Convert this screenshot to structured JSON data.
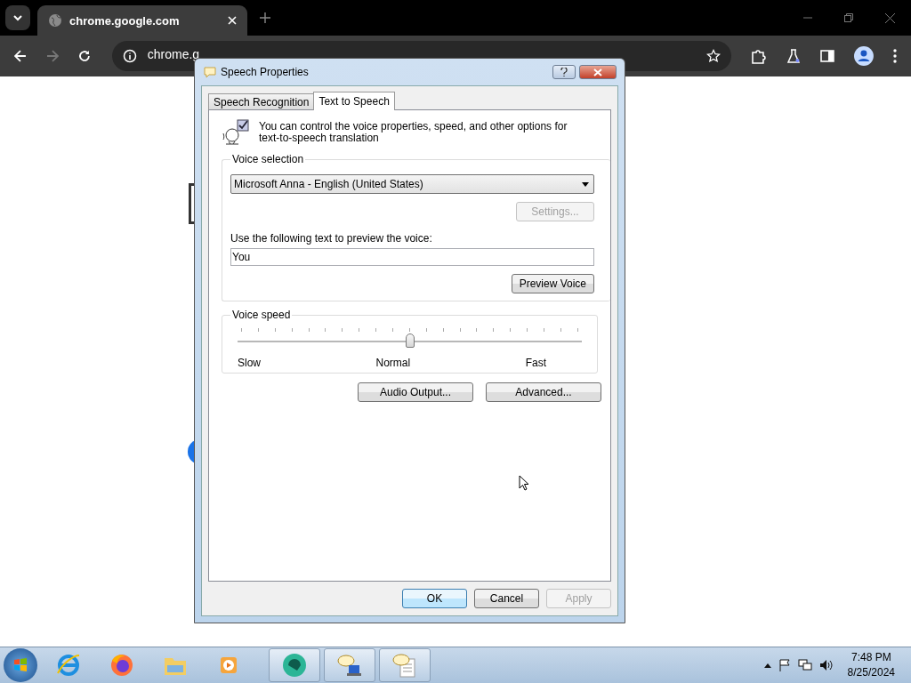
{
  "browser": {
    "tab_title": "chrome.google.com",
    "address": "chrome.g"
  },
  "dialog": {
    "title": "Speech Properties",
    "tabs": [
      {
        "label": "Speech Recognition",
        "selected": false
      },
      {
        "label": "Text to Speech",
        "selected": true
      }
    ],
    "intro": "You can control the voice properties, speed, and other options for text-to-speech translation",
    "voice_selection": {
      "legend": "Voice selection",
      "voice": "Microsoft Anna - English (United States)",
      "settings_button": {
        "label": "Settings...",
        "disabled": true
      },
      "preview_label": "Use the following text to preview the voice:",
      "preview_text": "You",
      "preview_button": "Preview Voice"
    },
    "voice_speed": {
      "legend": "Voice speed",
      "level": 0.5,
      "labels": [
        "Slow",
        "Normal",
        "Fast"
      ]
    },
    "buttons": [
      "Audio Output...",
      "Advanced..."
    ],
    "footer": [
      {
        "label": "OK",
        "default": true,
        "disabled": false
      },
      {
        "label": "Cancel",
        "default": false,
        "disabled": false
      },
      {
        "label": "Apply",
        "default": false,
        "disabled": true
      }
    ]
  },
  "taskbar": {
    "time": "7:48 PM",
    "date": "8/25/2024"
  }
}
